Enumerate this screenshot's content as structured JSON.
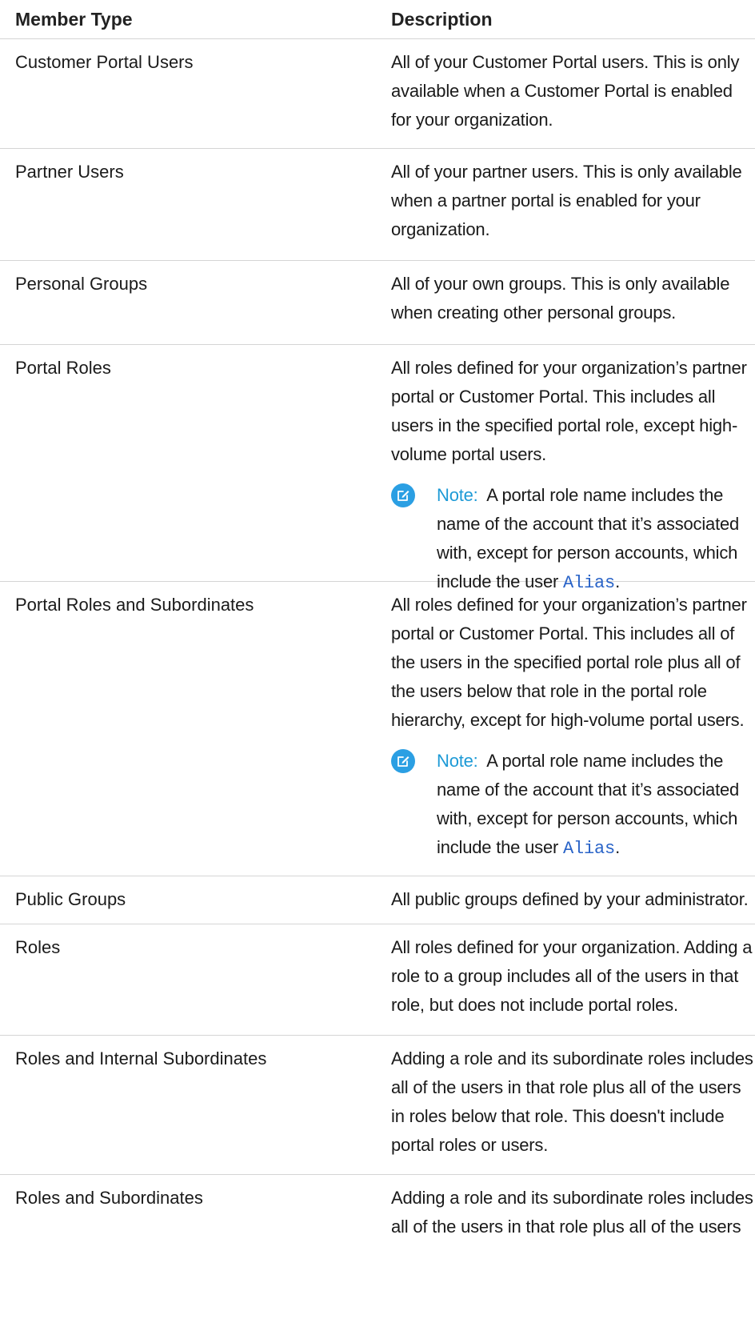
{
  "table": {
    "headers": {
      "member_type": "Member Type",
      "description": "Description"
    },
    "rows": [
      {
        "type": "Customer Portal Users",
        "description": "All of your Customer Portal users. This is only available when a Customer Portal is enabled for your organization."
      },
      {
        "type": "Partner Users",
        "description": "All of your partner users. This is only available when a partner portal is enabled for your organization."
      },
      {
        "type": "Personal Groups",
        "description": "All of your own groups. This is only available when creating other personal groups."
      },
      {
        "type": "Portal Roles",
        "description": "All roles defined for your organization’s partner portal or Customer Portal. This includes all users in the specified portal role, except high-volume portal users.",
        "note": {
          "label": "Note:",
          "text": "A portal role name includes the name of the account that it’s associated with, except for person accounts, which include the user",
          "code": "Alias",
          "suffix": "."
        }
      },
      {
        "type": "Portal Roles and Subordinates",
        "description": "All roles defined for your organization’s partner portal or Customer Portal. This includes all of the users in the specified portal role plus all of the users below that role in the portal role hierarchy, except for high-volume portal users.",
        "note": {
          "label": "Note:",
          "text": "A portal role name includes the name of the account that it’s associated with, except for person accounts, which include the user",
          "code": "Alias",
          "suffix": "."
        }
      },
      {
        "type": "Public Groups",
        "description": "All public groups defined by your administrator."
      },
      {
        "type": "Roles",
        "description": "All roles defined for your organization. Adding a role to a group includes all of the users in that role, but does not include portal roles."
      },
      {
        "type": "Roles and Internal Subordinates",
        "description": "Adding a role and its subordinate roles includes all of the users in that role plus all of the users in roles below that role. This doesn't include portal roles or users."
      },
      {
        "type": "Roles and Subordinates",
        "description": "Adding a role and its subordinate roles includes all of the users in that role plus all of the users"
      }
    ]
  },
  "icons": {
    "note": "edit-note-icon"
  },
  "colors": {
    "note_icon_bg": "#2b9fe3",
    "note_label": "#1d9ad6",
    "code_text": "#2a64c8",
    "row_divider": "#d5d5d5"
  }
}
